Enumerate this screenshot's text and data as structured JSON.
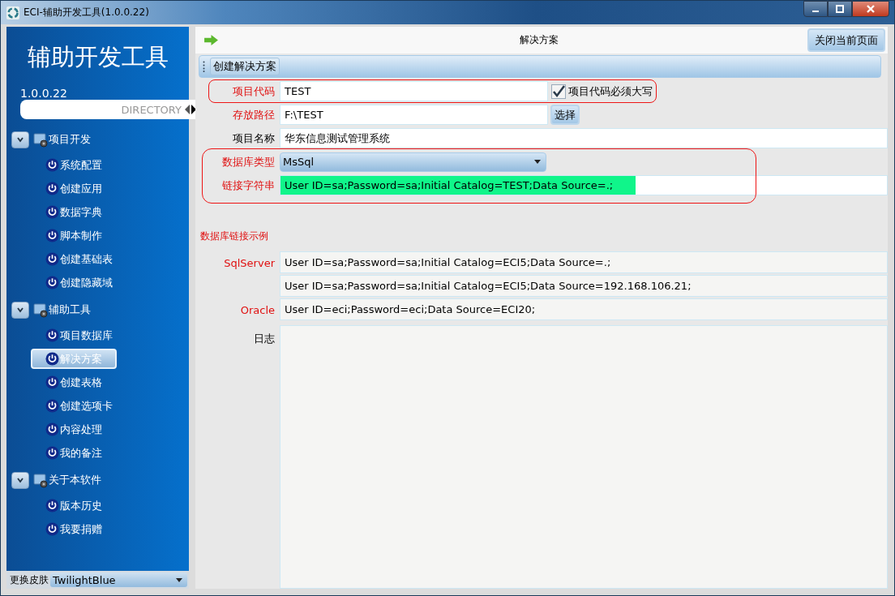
{
  "window": {
    "title": "ECI-辅助开发工具(1.0.0.22)"
  },
  "sidebar": {
    "app_name": "辅助开发工具",
    "version": "1.0.0.22",
    "directory_label": "DIRECTORY",
    "sections": [
      {
        "label": "项目开发",
        "expanded": true,
        "children": [
          {
            "label": "系统配置",
            "selected": false
          },
          {
            "label": "创建应用",
            "selected": false
          },
          {
            "label": "数据字典",
            "selected": false
          },
          {
            "label": "脚本制作",
            "selected": false
          },
          {
            "label": "创建基础表",
            "selected": false
          },
          {
            "label": "创建隐藏域",
            "selected": false
          }
        ]
      },
      {
        "label": "辅助工具",
        "expanded": true,
        "children": [
          {
            "label": "项目数据库",
            "selected": false
          },
          {
            "label": "解决方案",
            "selected": true
          },
          {
            "label": "创建表格",
            "selected": false
          },
          {
            "label": "创建选项卡",
            "selected": false
          },
          {
            "label": "内容处理",
            "selected": false
          },
          {
            "label": "我的备注",
            "selected": false
          }
        ]
      },
      {
        "label": "关于本软件",
        "expanded": true,
        "children": [
          {
            "label": "版本历史",
            "selected": false
          },
          {
            "label": "我要捐赠",
            "selected": false
          }
        ]
      }
    ],
    "skin_label": "更换皮肤",
    "skin_value": "TwilightBlue"
  },
  "page": {
    "title": "解决方案",
    "close_button": "关闭当前页面",
    "toolbar_button": "创建解决方案"
  },
  "form_groups": [
    {
      "outlined": true,
      "rows": [
        {
          "kind": "text",
          "label": "项目代码",
          "required": true,
          "value": "TEST",
          "checkbox": {
            "label": "项目代码必须大写",
            "checked": true
          }
        }
      ]
    },
    {
      "rows": [
        {
          "kind": "path",
          "label": "存放路径",
          "required": true,
          "value": "F:\\TEST",
          "button": "选择"
        },
        {
          "kind": "wide",
          "label": "项目名称",
          "required": false,
          "value": "华东信息测试管理系统"
        }
      ]
    },
    {
      "outlined": true,
      "rows": [
        {
          "kind": "select",
          "label": "数据库类型",
          "required": true,
          "value": "MsSql"
        },
        {
          "kind": "wide",
          "label": "链接字符串",
          "required": true,
          "value": "User ID=sa;Password=sa;Initial Catalog=TEST;Data Source=.;",
          "selected": true
        }
      ]
    }
  ],
  "examples": {
    "heading": "数据库链接示例",
    "rows": [
      {
        "label": "SqlServer",
        "value": "User ID=sa;Password=sa;Initial Catalog=ECI5;Data Source=.;"
      },
      {
        "value": "User ID=sa;Password=sa;Initial Catalog=ECI5;Data Source=192.168.106.21;"
      },
      {
        "label": "Oracle",
        "value": "User ID=eci;Password=eci;Data Source=ECI20;"
      }
    ]
  },
  "log": {
    "label": "日志"
  }
}
